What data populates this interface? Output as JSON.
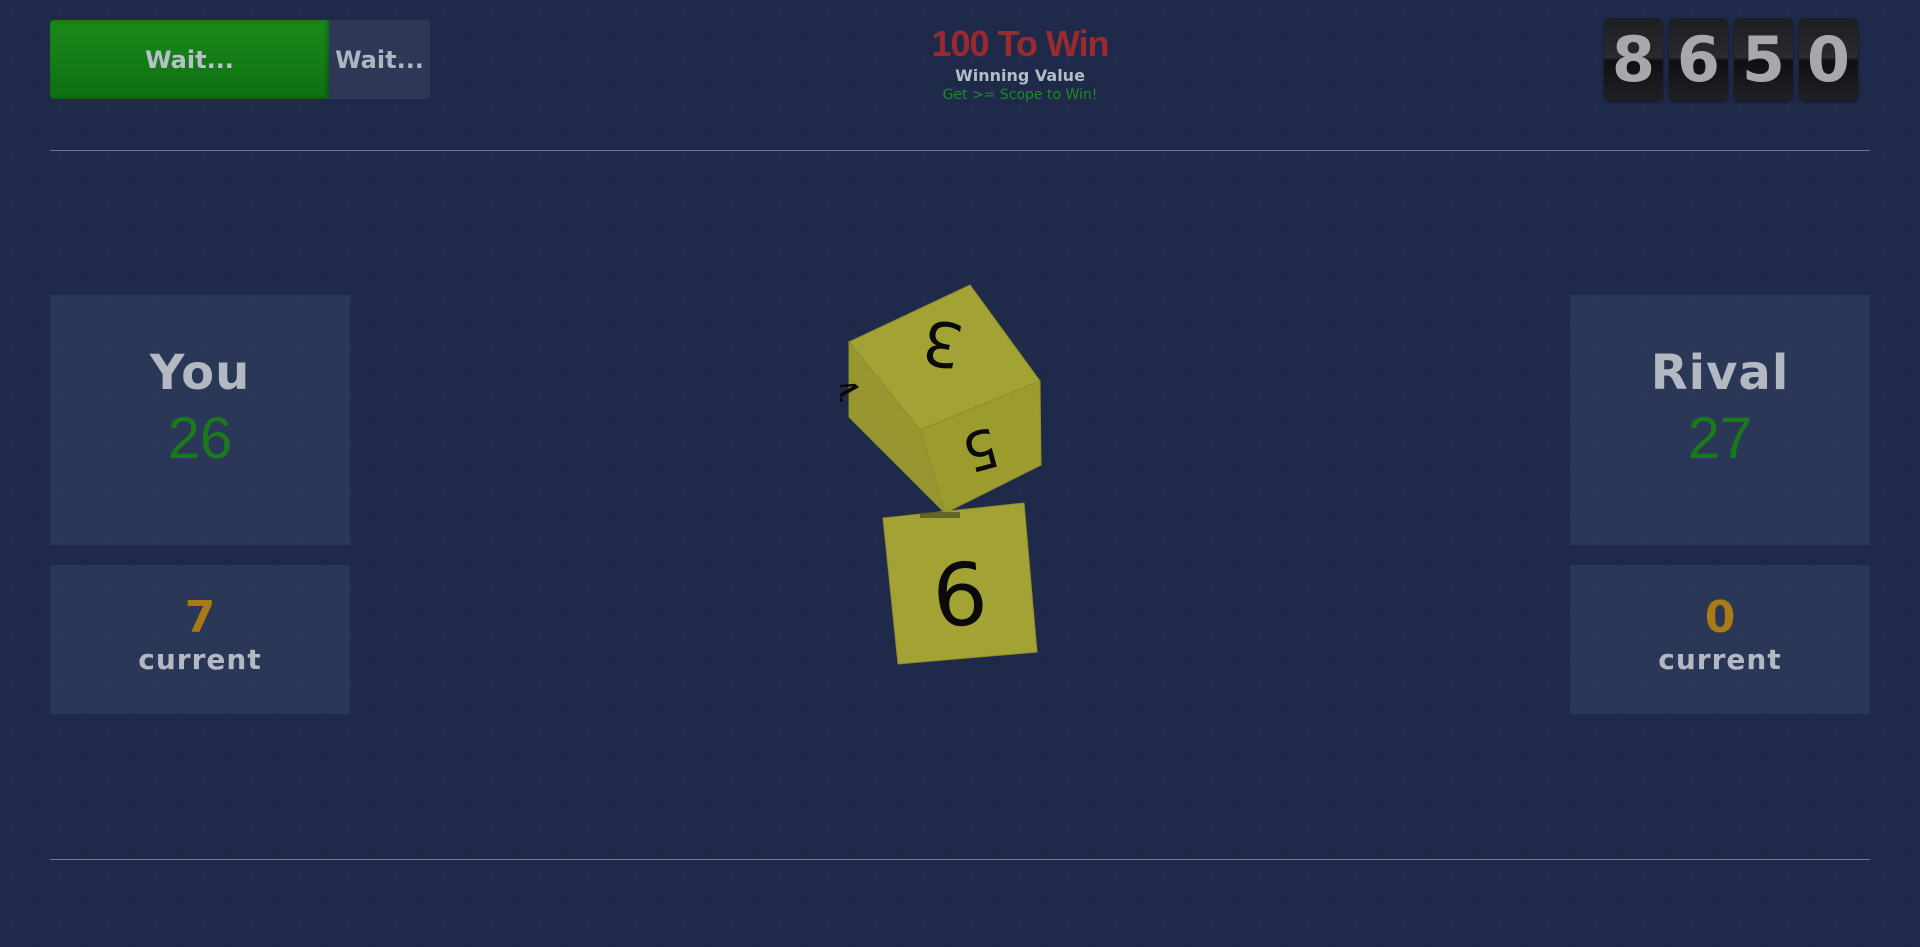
{
  "controls": {
    "primary_label": "Wait...",
    "secondary_label": "Wait..."
  },
  "goal": {
    "title": "100 To Win",
    "label": "Winning Value",
    "hint": "Get >= Scope to Win!"
  },
  "counter": {
    "digits": [
      "8",
      "6",
      "5",
      "0"
    ]
  },
  "players": {
    "you": {
      "name": "You",
      "score": "26",
      "current": "7",
      "current_label": "current"
    },
    "rival": {
      "name": "Rival",
      "score": "27",
      "current": "0",
      "current_label": "current"
    }
  },
  "dice": {
    "die1": {
      "top_face": "3",
      "front_face": "5",
      "side_face": "4"
    },
    "die2": {
      "front_face": "6"
    }
  },
  "colors": {
    "background": "#1f2a4a",
    "accent_green": "#0f6f12",
    "score_green": "#1a7a1a",
    "title_red": "#9b2a2e",
    "current_gold": "#a87b14",
    "die_yellow": "#a3a234"
  }
}
